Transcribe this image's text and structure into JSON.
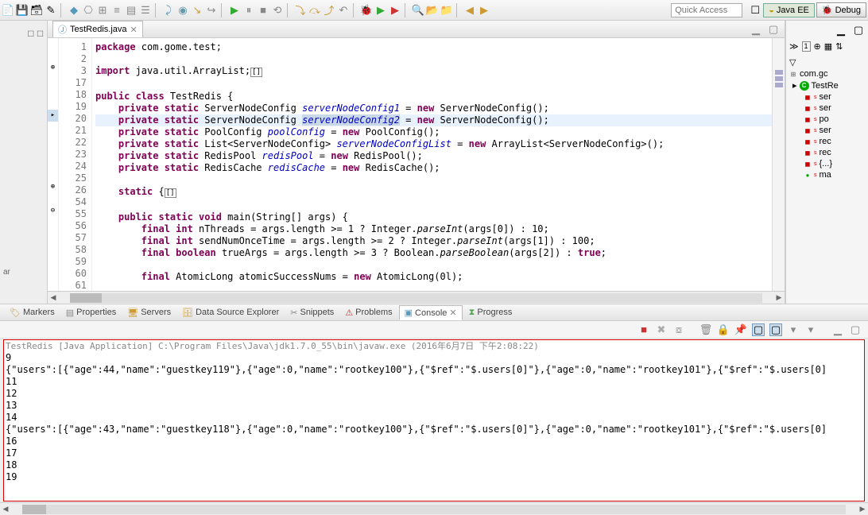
{
  "toolbar": {
    "quick_access_placeholder": "Quick Access"
  },
  "perspectives": {
    "javaee": "Java EE",
    "debug": "Debug"
  },
  "editor": {
    "filename": "TestRedis.java",
    "line_numbers": [
      "1",
      "2",
      "3",
      "17",
      "18",
      "19",
      "20",
      "21",
      "22",
      "23",
      "24",
      "25",
      "26",
      "54",
      "55",
      "56",
      "57",
      "58",
      "59",
      "60",
      "61"
    ],
    "code": {
      "l1": {
        "pre": "",
        "kw": "package",
        "rest": " com.gome.test;"
      },
      "l3": {
        "pre": "",
        "kw": "import",
        "rest": " java.util.ArrayList;",
        "bracket": "[]"
      },
      "l18": {
        "pre": "",
        "kw": "public class",
        "rest": " TestRedis {"
      },
      "l19": {
        "pre": "    ",
        "kw": "private static",
        "type": " ServerNodeConfig ",
        "fld": "serverNodeConfig1",
        "rest": " = ",
        "kw2": "new",
        "rest2": " ServerNodeConfig();"
      },
      "l20": {
        "pre": "    ",
        "kw": "private static",
        "type": " ServerNodeConfig ",
        "fld": "serverNodeConfig2",
        "rest": " = ",
        "kw2": "new",
        "rest2": " ServerNodeConfig();"
      },
      "l21": {
        "pre": "    ",
        "kw": "private static",
        "type": " PoolConfig ",
        "fld": "poolConfig",
        "rest": " = ",
        "kw2": "new",
        "rest2": " PoolConfig();"
      },
      "l22": {
        "pre": "    ",
        "kw": "private static",
        "type": " List<ServerNodeConfig> ",
        "fld": "serverNodeConfigList",
        "rest": " = ",
        "kw2": "new",
        "rest2": " ArrayList<ServerNodeConfig>();"
      },
      "l23": {
        "pre": "    ",
        "kw": "private static",
        "type": " RedisPool ",
        "fld": "redisPool",
        "rest": " = ",
        "kw2": "new",
        "rest2": " RedisPool();"
      },
      "l24": {
        "pre": "    ",
        "kw": "private static",
        "type": " RedisCache ",
        "fld": "redisCache",
        "rest": " = ",
        "kw2": "new",
        "rest2": " RedisCache();"
      },
      "l26": {
        "pre": "    ",
        "kw": "static",
        "rest": " {",
        "bracket": "[]"
      },
      "l55": {
        "pre": "    ",
        "kw": "public static void",
        "rest": " main(String[] args) {"
      },
      "l56": {
        "pre": "        ",
        "kw": "final int",
        "rest": " nThreads = args.length >= 1 ? Integer.",
        "stm": "parseInt",
        "rest2": "(args[0]) : 10;"
      },
      "l57": {
        "pre": "        ",
        "kw": "final int",
        "rest": " sendNumOnceTime = args.length >= 2 ? Integer.",
        "stm": "parseInt",
        "rest2": "(args[1]) : 100;"
      },
      "l58": {
        "pre": "        ",
        "kw": "final boolean",
        "rest": " trueArgs = args.length >= 3 ? Boolean.",
        "stm": "parseBoolean",
        "rest2": "(args[2]) : ",
        "kw2": "true",
        "rest3": ";"
      },
      "l60": {
        "pre": "        ",
        "kw": "final",
        "type": " AtomicLong ",
        "rest": "atomicSuccessNums = ",
        "kw2": "new",
        "rest2": " AtomicLong(0l);"
      }
    }
  },
  "outline": {
    "header_icons": [
      "⊕",
      "▦",
      "⇅"
    ],
    "items": [
      {
        "icon": "pkg",
        "label": "com.gc"
      },
      {
        "icon": "cls",
        "label": "TestRe"
      },
      {
        "icon": "s",
        "label": "ser"
      },
      {
        "icon": "s",
        "label": "ser"
      },
      {
        "icon": "s",
        "label": "po"
      },
      {
        "icon": "s",
        "label": "ser"
      },
      {
        "icon": "s",
        "label": "rec"
      },
      {
        "icon": "s",
        "label": "rec"
      },
      {
        "icon": "s",
        "label": "{...}"
      },
      {
        "icon": "m",
        "label": "ma"
      }
    ]
  },
  "bottom_tabs": {
    "markers": "Markers",
    "properties": "Properties",
    "servers": "Servers",
    "dse": "Data Source Explorer",
    "snippets": "Snippets",
    "problems": "Problems",
    "console": "Console",
    "progress": "Progress"
  },
  "console": {
    "title": "TestRedis [Java Application] C:\\Program Files\\Java\\jdk1.7.0_55\\bin\\javaw.exe (2016年6月7日 下午2:08:22)",
    "lines": [
      "9",
      "{\"users\":[{\"age\":44,\"name\":\"guestkey119\"},{\"age\":0,\"name\":\"rootkey100\"},{\"$ref\":\"$.users[0]\"},{\"age\":0,\"name\":\"rootkey101\"},{\"$ref\":\"$.users[0]",
      "11",
      "12",
      "13",
      "14",
      "{\"users\":[{\"age\":43,\"name\":\"guestkey118\"},{\"age\":0,\"name\":\"rootkey100\"},{\"$ref\":\"$.users[0]\"},{\"age\":0,\"name\":\"rootkey101\"},{\"$ref\":\"$.users[0]",
      "16",
      "17",
      "18",
      "19"
    ]
  },
  "left_label": "ar"
}
